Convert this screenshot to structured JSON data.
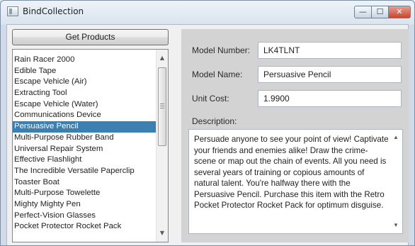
{
  "window": {
    "title": "BindCollection",
    "controls": {
      "minimize": "—",
      "maximize": "☐",
      "close": "✕"
    }
  },
  "left_panel": {
    "get_products_label": "Get Products",
    "products": [
      "Rain Racer 2000",
      "Edible Tape",
      "Escape Vehicle (Air)",
      "Extracting Tool",
      "Escape Vehicle (Water)",
      "Communications Device",
      "Persuasive Pencil",
      "Multi-Purpose Rubber Band",
      "Universal Repair System",
      "Effective Flashlight",
      "The Incredible Versatile Paperclip",
      "Toaster Boat",
      "Multi-Purpose Towelette",
      "Mighty Mighty Pen",
      "Perfect-Vision Glasses",
      "Pocket Protector Rocket Pack"
    ],
    "selected_product": "Persuasive Pencil"
  },
  "details": {
    "model_number_label": "Model Number:",
    "model_number": "LK4TLNT",
    "model_name_label": "Model Name:",
    "model_name": "Persuasive Pencil",
    "unit_cost_label": "Unit Cost:",
    "unit_cost": "1.9900",
    "description_label": "Description:",
    "description": "Persuade anyone to see your point of view! Captivate your friends and enemies alike! Draw the crime-scene or map out the chain of events. All you need is several years of training or copious amounts of natural talent. You're halfway there with the Persuasive Pencil. Purchase this item with the Retro Pocket Protector Rocket Pack for optimum disguise."
  },
  "scrollbar_icons": {
    "up": "up-arrow-icon",
    "down": "down-arrow-icon"
  }
}
